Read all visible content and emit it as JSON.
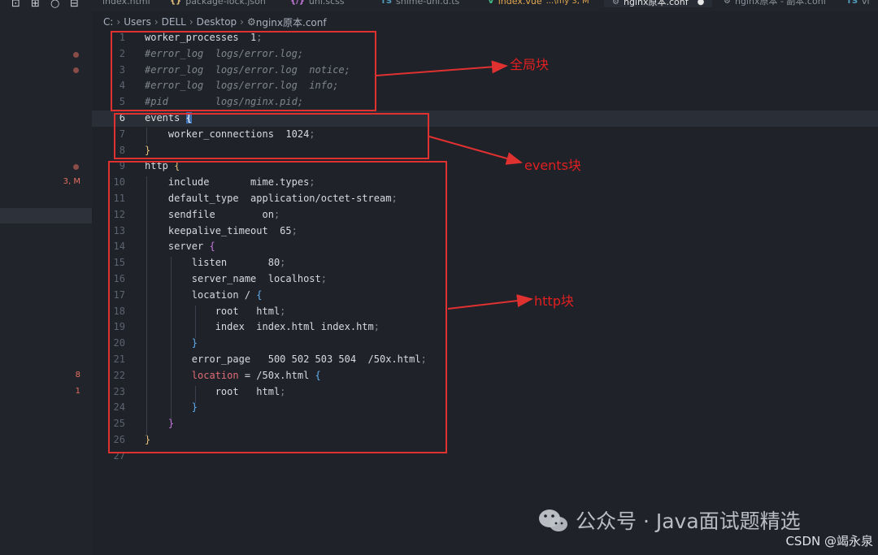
{
  "tabs": [
    {
      "label": "index.html",
      "icon": "",
      "color": "#8b919c"
    },
    {
      "label": "package-lock.json",
      "icon": "{}",
      "color": "#e5c07b"
    },
    {
      "label": "uni.scss",
      "icon": "{/}",
      "color": "#c678dd"
    },
    {
      "label": "shime-uni.d.ts",
      "icon": "TS",
      "color": "#519aba"
    },
    {
      "label": "index.vue",
      "icon": "V",
      "color": "#41b883",
      "suffix": "...\\my 3, M"
    },
    {
      "label": "nginx原本.conf",
      "icon": "⚙",
      "color": "#9aa0aa",
      "active": true
    },
    {
      "label": "nginx原本 - 副本.conf",
      "icon": "⚙",
      "color": "#9aa0aa"
    },
    {
      "label": "vi",
      "icon": "TS",
      "color": "#519aba"
    }
  ],
  "breadcrumb": [
    "C:",
    "Users",
    "DELL",
    "Desktop",
    "nginx原本.conf"
  ],
  "sidebar": {
    "badges": [
      {
        "count": "3, M"
      },
      {
        "count": "8"
      },
      {
        "count": "1"
      }
    ]
  },
  "editor": {
    "lines": [
      {
        "n": "1",
        "tokens": [
          [
            "worker_processes  1",
            ""
          ],
          [
            ";",
            "c-sc"
          ]
        ]
      },
      {
        "n": "2",
        "tokens": [
          [
            "#error_log  logs/error.log;",
            "c-cm"
          ]
        ]
      },
      {
        "n": "3",
        "tokens": [
          [
            "#error_log  logs/error.log  notice;",
            "c-cm"
          ]
        ]
      },
      {
        "n": "4",
        "tokens": [
          [
            "#error_log  logs/error.log  info;",
            "c-cm"
          ]
        ]
      },
      {
        "n": "5",
        "tokens": [
          [
            "#pid        logs/nginx.pid;",
            "c-cm"
          ]
        ]
      },
      {
        "n": "6",
        "tokens": [
          [
            "events ",
            ""
          ],
          [
            "{",
            "bm-hl"
          ]
        ],
        "cur": true
      },
      {
        "n": "7",
        "tokens": [
          [
            "    worker_connections  1024",
            ""
          ],
          [
            ";",
            "c-sc"
          ]
        ]
      },
      {
        "n": "8",
        "tokens": [
          [
            "}",
            "c-yl"
          ]
        ]
      },
      {
        "n": "9",
        "tokens": [
          [
            "http ",
            ""
          ],
          [
            "{",
            "c-yl"
          ]
        ]
      },
      {
        "n": "10",
        "tokens": [
          [
            "    include       mime.types",
            ""
          ],
          [
            ";",
            "c-sc"
          ]
        ]
      },
      {
        "n": "11",
        "tokens": [
          [
            "    default_type  application/octet-stream",
            ""
          ],
          [
            ";",
            "c-sc"
          ]
        ]
      },
      {
        "n": "12",
        "tokens": [
          [
            "    sendfile        on",
            ""
          ],
          [
            ";",
            "c-sc"
          ]
        ]
      },
      {
        "n": "13",
        "tokens": [
          [
            "    keepalive_timeout  65",
            ""
          ],
          [
            ";",
            "c-sc"
          ]
        ]
      },
      {
        "n": "14",
        "tokens": [
          [
            "    server ",
            ""
          ],
          [
            "{",
            "c-pu"
          ]
        ]
      },
      {
        "n": "15",
        "tokens": [
          [
            "        listen       80",
            ""
          ],
          [
            ";",
            "c-sc"
          ]
        ]
      },
      {
        "n": "16",
        "tokens": [
          [
            "        server_name  localhost",
            ""
          ],
          [
            ";",
            "c-sc"
          ]
        ]
      },
      {
        "n": "17",
        "tokens": [
          [
            "        location / ",
            ""
          ],
          [
            "{",
            "c-bl"
          ]
        ]
      },
      {
        "n": "18",
        "tokens": [
          [
            "            root   html",
            ""
          ],
          [
            ";",
            "c-sc"
          ]
        ]
      },
      {
        "n": "19",
        "tokens": [
          [
            "            index  index.html index.htm",
            ""
          ],
          [
            ";",
            "c-sc"
          ]
        ]
      },
      {
        "n": "20",
        "tokens": [
          [
            "        ",
            ""
          ],
          [
            "}",
            "c-bl"
          ]
        ]
      },
      {
        "n": "21",
        "tokens": [
          [
            "        error_page   500 502 503 504  /50x.html",
            ""
          ],
          [
            ";",
            "c-sc"
          ]
        ]
      },
      {
        "n": "22",
        "tokens": [
          [
            "        ",
            ""
          ],
          [
            "location",
            "c-kw"
          ],
          [
            " = /50x.html ",
            ""
          ],
          [
            "{",
            "c-bl"
          ]
        ]
      },
      {
        "n": "23",
        "tokens": [
          [
            "            root   html",
            ""
          ],
          [
            ";",
            "c-sc"
          ]
        ]
      },
      {
        "n": "24",
        "tokens": [
          [
            "        ",
            ""
          ],
          [
            "}",
            "c-bl"
          ]
        ]
      },
      {
        "n": "25",
        "tokens": [
          [
            "    ",
            ""
          ],
          [
            "}",
            "c-pu"
          ]
        ]
      },
      {
        "n": "26",
        "tokens": [
          [
            "}",
            "c-yl"
          ]
        ]
      },
      {
        "n": "27",
        "tokens": []
      }
    ]
  },
  "annotations": {
    "global_label": "全局块",
    "events_label": "events块",
    "http_label": "http块",
    "color": "#e03131"
  },
  "watermark": {
    "wechat_text": "公众号 · Java面试题精选",
    "csdn_text": "CSDN @竭永泉"
  }
}
